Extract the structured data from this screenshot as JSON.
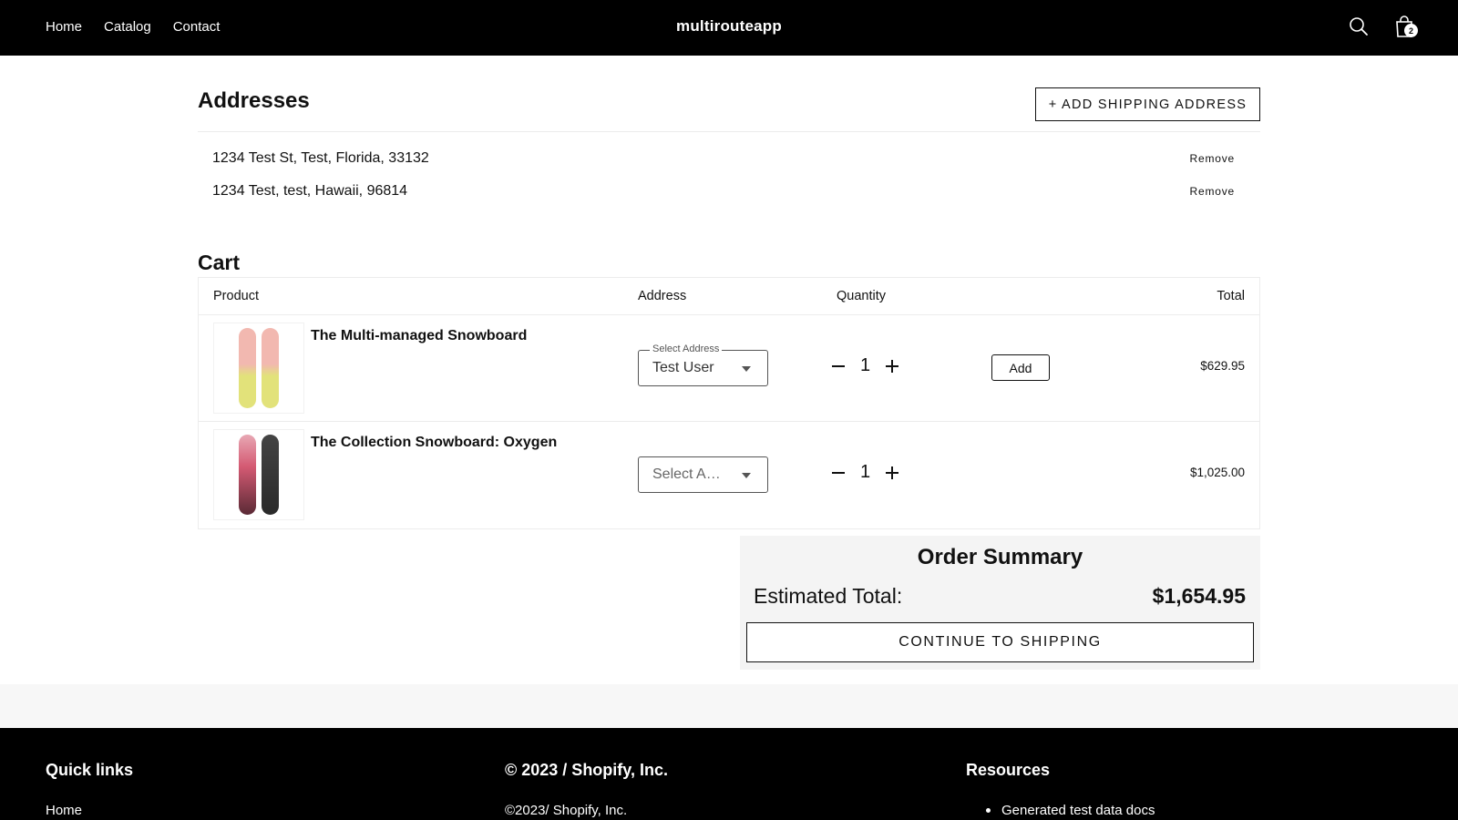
{
  "header": {
    "nav": [
      "Home",
      "Catalog",
      "Contact"
    ],
    "brand": "multirouteapp",
    "cart_count": "2"
  },
  "addresses": {
    "title": "Addresses",
    "add_button": "+ ADD SHIPPING ADDRESS",
    "items": [
      {
        "text": "1234 Test St, Test, Florida, 33132",
        "remove": "Remove"
      },
      {
        "text": "1234 Test, test, Hawaii, 96814",
        "remove": "Remove"
      }
    ]
  },
  "cart": {
    "title": "Cart",
    "columns": {
      "product": "Product",
      "address": "Address",
      "quantity": "Quantity",
      "total": "Total"
    },
    "items": [
      {
        "name": "The Multi-managed Snowboard",
        "select_label": "Select Address",
        "select_value": "Test User",
        "quantity": "1",
        "add_label": "Add",
        "total": "$629.95"
      },
      {
        "name": "The Collection Snowboard: Oxygen",
        "select_value": "Select A…",
        "quantity": "1",
        "total": "$1,025.00"
      }
    ]
  },
  "summary": {
    "title": "Order Summary",
    "estimated_label": "Estimated Total:",
    "estimated_value": "$1,654.95",
    "continue_label": "CONTINUE TO SHIPPING"
  },
  "footer": {
    "quick_links_title": "Quick links",
    "quick_links": [
      "Home"
    ],
    "copyright_title": "© 2023 / Shopify, Inc.",
    "copyright_text": "©2023/ Shopify, Inc.",
    "resources_title": "Resources",
    "resources": [
      "Generated test data docs"
    ]
  },
  "colors": {
    "header_bg": "#000000",
    "summary_bg": "#f4f4f4",
    "board1_top": "#f2b8b0",
    "board1_bottom": "#e2e27a",
    "board2_a": "#d45a73",
    "board2_b": "#2a2a2a"
  }
}
